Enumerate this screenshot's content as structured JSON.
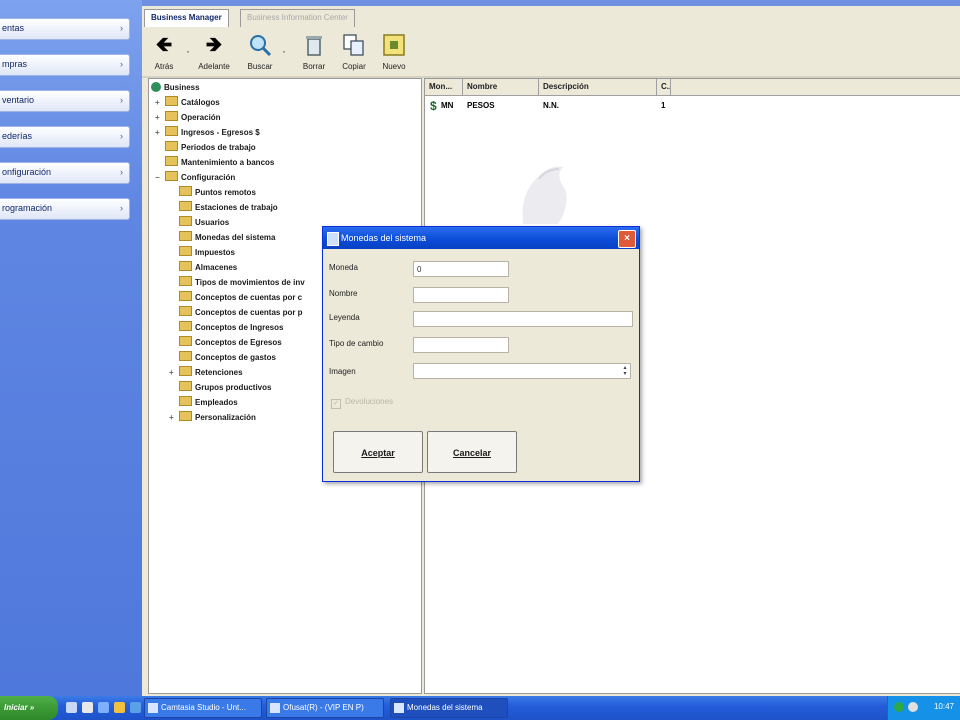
{
  "left_panel": {
    "buttons": [
      {
        "label": "entas"
      },
      {
        "label": "mpras"
      },
      {
        "label": "ventario"
      },
      {
        "label": "ederías"
      },
      {
        "label": "onfiguración"
      },
      {
        "label": "rogramación"
      }
    ]
  },
  "app": {
    "tabs": [
      {
        "label": "Business Manager",
        "active": true
      },
      {
        "label": "Business Information Center",
        "active": false
      }
    ],
    "toolbar": {
      "buttons": [
        {
          "label": "Atrás",
          "icon": "back-arrow-icon"
        },
        {
          "label": "Adelante",
          "icon": "forward-arrow-icon"
        },
        {
          "label": "Buscar",
          "icon": "search-icon"
        },
        {
          "label": "Borrar",
          "icon": "trash-icon"
        },
        {
          "label": "Copiar",
          "icon": "copy-icon"
        },
        {
          "label": "Nuevo",
          "icon": "new-icon"
        }
      ]
    },
    "tree": {
      "root": "Business",
      "items": [
        {
          "label": "Catálogos",
          "level": 1,
          "expander": "+"
        },
        {
          "label": "Operación",
          "level": 1,
          "expander": "+"
        },
        {
          "label": "Ingresos - Egresos $",
          "level": 1,
          "expander": "+"
        },
        {
          "label": "Periodos de trabajo",
          "level": 1,
          "expander": ""
        },
        {
          "label": "Mantenimiento a bancos",
          "level": 1,
          "expander": ""
        },
        {
          "label": "Configuración",
          "level": 1,
          "expander": "−"
        },
        {
          "label": "Puntos remotos",
          "level": 2,
          "expander": ""
        },
        {
          "label": "Estaciones de trabajo",
          "level": 2,
          "expander": ""
        },
        {
          "label": "Usuarios",
          "level": 2,
          "expander": ""
        },
        {
          "label": "Monedas del sistema",
          "level": 2,
          "expander": ""
        },
        {
          "label": "Impuestos",
          "level": 2,
          "expander": ""
        },
        {
          "label": "Almacenes",
          "level": 2,
          "expander": ""
        },
        {
          "label": "Tipos de movimientos de inv",
          "level": 2,
          "expander": ""
        },
        {
          "label": "Conceptos de cuentas por c",
          "level": 2,
          "expander": ""
        },
        {
          "label": "Conceptos de cuentas por p",
          "level": 2,
          "expander": ""
        },
        {
          "label": "Conceptos de Ingresos",
          "level": 2,
          "expander": ""
        },
        {
          "label": "Conceptos de Egresos",
          "level": 2,
          "expander": ""
        },
        {
          "label": "Conceptos de gastos",
          "level": 2,
          "expander": ""
        },
        {
          "label": "Retenciones",
          "level": 2,
          "expander": "+"
        },
        {
          "label": "Grupos productivos",
          "level": 2,
          "expander": ""
        },
        {
          "label": "Empleados",
          "level": 2,
          "expander": ""
        },
        {
          "label": "Personalización",
          "level": 2,
          "expander": "+"
        }
      ]
    },
    "list": {
      "columns": [
        "Mon...",
        "Nombre",
        "Descripción",
        "C..."
      ],
      "rows": [
        {
          "moneda": "MN",
          "nombre": "PESOS",
          "descripcion": "N.N.",
          "c": "1"
        }
      ]
    }
  },
  "dialog": {
    "title": "Monedas del sistema",
    "fields": {
      "moneda": {
        "label": "Moneda",
        "value": "0"
      },
      "nombre": {
        "label": "Nombre",
        "value": ""
      },
      "leyenda": {
        "label": "Leyenda",
        "value": ""
      },
      "tipo_cambio": {
        "label": "Tipo de cambio",
        "value": ""
      },
      "imagen": {
        "label": "Imagen",
        "value": ""
      }
    },
    "checkbox_label": "Devoluciones",
    "accept_label": "Aceptar",
    "cancel_label": "Cancelar"
  },
  "taskbar": {
    "start_label": "Iniciar",
    "tasks": [
      {
        "label": "Camtasia Studio - Unt...",
        "active": false
      },
      {
        "label": "Ofusat(R) - (VIP EN P)",
        "active": false
      },
      {
        "label": "Monedas del sistema",
        "active": true
      }
    ],
    "clock": "10:47"
  },
  "colors": {
    "accent": "#245edb",
    "dialog_title": "#0a4bd6",
    "start_green": "#3c9a36"
  }
}
